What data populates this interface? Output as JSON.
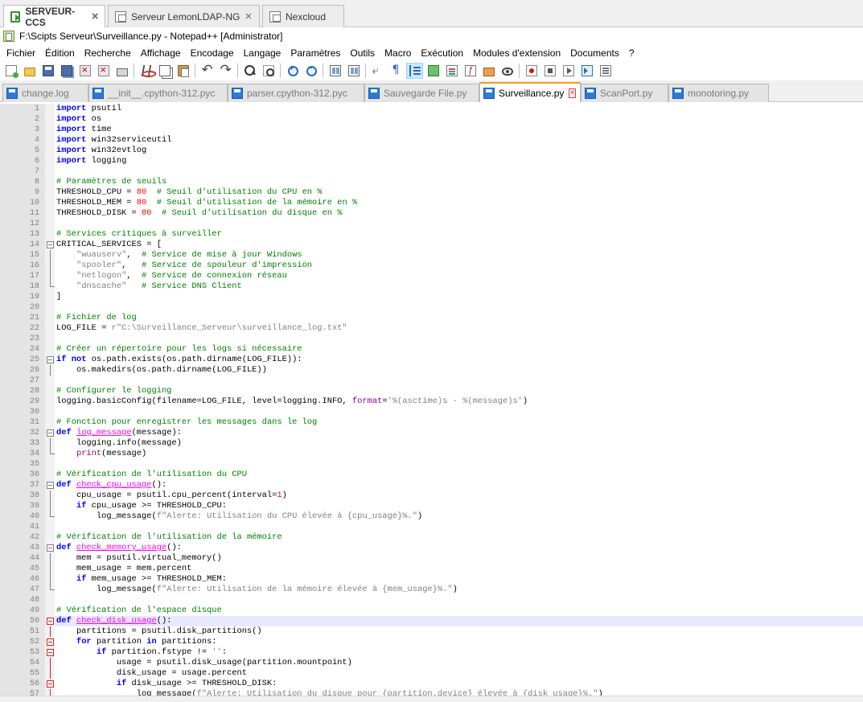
{
  "rdp_tabs": [
    {
      "label": "SERVEUR-CCS",
      "active": true,
      "icon": "remote-desktop-icon"
    },
    {
      "label": "Serveur LemonLDAP-NG",
      "active": false,
      "icon": "window-icon"
    },
    {
      "label": "Nexcloud",
      "active": false,
      "icon": "window-icon"
    }
  ],
  "window": {
    "title": "F:\\Scipts Serveur\\Surveillance.py - Notepad++ [Administrator]"
  },
  "menu": [
    "Fichier",
    "Édition",
    "Recherche",
    "Affichage",
    "Encodage",
    "Langage",
    "Paramètres",
    "Outils",
    "Macro",
    "Exécution",
    "Modules d'extension",
    "Documents",
    "?"
  ],
  "toolbar_icons": [
    "new-file-icon",
    "open-file-icon",
    "save-icon",
    "save-all-icon",
    "close-icon",
    "close-all-icon",
    "print-icon",
    "cut-icon",
    "copy-icon",
    "paste-icon",
    "undo-icon",
    "redo-icon",
    "find-icon",
    "replace-icon",
    "zoom-in-icon",
    "zoom-out-icon",
    "sync-vertical-icon",
    "sync-horizontal-icon",
    "word-wrap-icon",
    "show-all-chars-icon",
    "indent-guide-icon",
    "user-language-icon",
    "document-map-icon",
    "function-list-icon",
    "folder-workspace-icon",
    "monitoring-icon",
    "record-macro-icon",
    "stop-recording-icon",
    "playback-macro-icon",
    "run-macro-multiple-icon",
    "save-macro-icon"
  ],
  "doc_tabs": [
    {
      "label": "change.log",
      "active": false
    },
    {
      "label": "__init__.cpython-312.pyc",
      "active": false
    },
    {
      "label": "parser.cpython-312.pyc",
      "active": false
    },
    {
      "label": "Sauvegarde File.py",
      "active": false
    },
    {
      "label": "Surveillance.py",
      "active": true
    },
    {
      "label": "ScanPort.py",
      "active": false
    },
    {
      "label": "monotoring.py",
      "active": false
    }
  ],
  "editor": {
    "current_line": 50,
    "colors": {
      "keyword": "#0000ff",
      "comment": "#008000",
      "number": "#ff0000",
      "string": "#808080",
      "function_name": "#ff00ff",
      "current_line": "#e8e8ff",
      "tab_accent": "#f39c20"
    },
    "lines": [
      "import psutil",
      "import os",
      "import time",
      "import win32serviceutil",
      "import win32evtlog",
      "import logging",
      "",
      "# Paramètres de seuils",
      "THRESHOLD_CPU = 80  # Seuil d'utilisation du CPU en %",
      "THRESHOLD_MEM = 80  # Seuil d'utilisation de la mémoire en %",
      "THRESHOLD_DISK = 80  # Seuil d'utilisation du disque en %",
      "",
      "# Services critiques à surveiller",
      "CRITICAL_SERVICES = [",
      "    \"wuauserv\",  # Service de mise à jour Windows",
      "    \"spooler\",   # Service de spouleur d'impression",
      "    \"netlogon\",  # Service de connexion réseau",
      "    \"dnscache\"   # Service DNS Client",
      "]",
      "",
      "# Fichier de log",
      "LOG_FILE = r\"C:\\Surveillance_Serveur\\surveillance_log.txt\"",
      "",
      "# Créer un répertoire pour les logs si nécessaire",
      "if not os.path.exists(os.path.dirname(LOG_FILE)):",
      "    os.makedirs(os.path.dirname(LOG_FILE))",
      "",
      "# Configurer le logging",
      "logging.basicConfig(filename=LOG_FILE, level=logging.INFO, format='%(asctime)s - %(message)s')",
      "",
      "# Fonction pour enregistrer les messages dans le log",
      "def log_message(message):",
      "    logging.info(message)",
      "    print(message)",
      "",
      "# Vérification de l'utilisation du CPU",
      "def check_cpu_usage():",
      "    cpu_usage = psutil.cpu_percent(interval=1)",
      "    if cpu_usage >= THRESHOLD_CPU:",
      "        log_message(f\"Alerte: Utilisation du CPU élevée à {cpu_usage}%.\")",
      "",
      "# Vérification de l'utilisation de la mémoire",
      "def check_memory_usage():",
      "    mem = psutil.virtual_memory()",
      "    mem_usage = mem.percent",
      "    if mem_usage >= THRESHOLD_MEM:",
      "        log_message(f\"Alerte: Utilisation de la mémoire élevée à {mem_usage}%.\")",
      "",
      "# Vérification de l'espace disque",
      "def check_disk_usage():",
      "    partitions = psutil.disk_partitions()",
      "    for partition in partitions:",
      "        if partition.fstype != '':",
      "            usage = psutil.disk_usage(partition.mountpoint)",
      "            disk_usage = usage.percent",
      "            if disk_usage >= THRESHOLD_DISK:",
      "                log_message(f\"Alerte: Utilisation du disque pour {partition.device} élevée à {disk_usage}%.\")"
    ]
  }
}
